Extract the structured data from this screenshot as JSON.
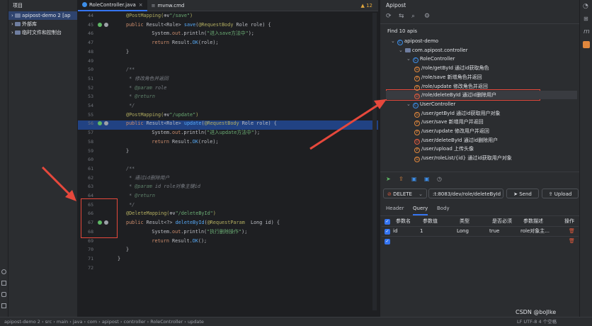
{
  "project": {
    "header": "项目",
    "items": [
      {
        "label": "apipost-demo 2 [ap"
      },
      {
        "label": "外部库"
      },
      {
        "label": "临时文件和控制台"
      }
    ]
  },
  "editor": {
    "tabs": [
      {
        "label": "RoleController.java"
      },
      {
        "label": "mvnw.cmd"
      }
    ],
    "warning_count": "12",
    "line_numbers": [
      "44",
      "45",
      "46",
      "47",
      "48",
      "49",
      "50",
      "51",
      "52",
      "53",
      "54",
      "55",
      "56",
      "57",
      "58",
      "59",
      "60",
      "61",
      "62",
      "63",
      "64",
      "65",
      "66",
      "67",
      "68",
      "69",
      "70",
      "71",
      "72"
    ],
    "lines": [
      [
        {
          "c": "an",
          "t": "@PostMapping("
        },
        {
          "c": "",
          "t": "⊕∨"
        },
        {
          "c": "st",
          "t": "\"/save\""
        },
        {
          "c": "an",
          "t": ")"
        }
      ],
      [
        {
          "c": "kw",
          "t": "public "
        },
        {
          "c": "",
          "t": "Result<Role> "
        },
        {
          "c": "fn",
          "t": "save"
        },
        {
          "c": "",
          "t": "("
        },
        {
          "c": "an",
          "t": "@RequestBody "
        },
        {
          "c": "",
          "t": "Role role) {"
        }
      ],
      [
        {
          "c": "",
          "t": "    System."
        },
        {
          "c": "kw",
          "t": "out"
        },
        {
          "c": "",
          "t": ".println("
        },
        {
          "c": "st",
          "t": "\"进入save方法中\""
        },
        {
          "c": "",
          "t": ");"
        }
      ],
      [
        {
          "c": "kw",
          "t": "    return "
        },
        {
          "c": "",
          "t": "Result."
        },
        {
          "c": "fn",
          "t": "OK"
        },
        {
          "c": "",
          "t": "(role);"
        }
      ],
      [
        {
          "c": "",
          "t": "}"
        }
      ],
      [
        {
          "c": "",
          "t": ""
        }
      ],
      [
        {
          "c": "cm",
          "t": "/**"
        }
      ],
      [
        {
          "c": "cm",
          "t": " * 修改角色并返回"
        }
      ],
      [
        {
          "c": "cm",
          "t": " * "
        },
        {
          "c": "tg",
          "t": "@param"
        },
        {
          "c": "cm",
          "t": " role"
        }
      ],
      [
        {
          "c": "cm",
          "t": " * "
        },
        {
          "c": "tg",
          "t": "@return"
        }
      ],
      [
        {
          "c": "cm",
          "t": " */"
        }
      ],
      [
        {
          "c": "an",
          "t": "@PostMapping("
        },
        {
          "c": "",
          "t": "⊕∨"
        },
        {
          "c": "st",
          "t": "\"/update\""
        },
        {
          "c": "an",
          "t": ")"
        }
      ],
      [
        {
          "c": "kw",
          "t": "public "
        },
        {
          "c": "",
          "t": "Result<Role> "
        },
        {
          "c": "fn",
          "t": "update"
        },
        {
          "c": "",
          "t": "("
        },
        {
          "c": "an",
          "t": "@RequestBody "
        },
        {
          "c": "",
          "t": "Role role) {"
        }
      ],
      [
        {
          "c": "",
          "t": "    System."
        },
        {
          "c": "kw",
          "t": "out"
        },
        {
          "c": "",
          "t": ".println("
        },
        {
          "c": "st",
          "t": "\"进入update方法中\""
        },
        {
          "c": "",
          "t": ");"
        }
      ],
      [
        {
          "c": "kw",
          "t": "    return "
        },
        {
          "c": "",
          "t": "Result."
        },
        {
          "c": "fn",
          "t": "OK"
        },
        {
          "c": "",
          "t": "(role);"
        }
      ],
      [
        {
          "c": "",
          "t": "}"
        }
      ],
      [
        {
          "c": "",
          "t": ""
        }
      ],
      [
        {
          "c": "cm",
          "t": "/**"
        }
      ],
      [
        {
          "c": "cm",
          "t": " * 通过id删除用户"
        }
      ],
      [
        {
          "c": "cm",
          "t": " * "
        },
        {
          "c": "tg",
          "t": "@param"
        },
        {
          "c": "cm",
          "t": " id role对象主键id"
        }
      ],
      [
        {
          "c": "cm",
          "t": " * "
        },
        {
          "c": "tg",
          "t": "@return"
        }
      ],
      [
        {
          "c": "cm",
          "t": " */"
        }
      ],
      [
        {
          "c": "an",
          "t": "@DeleteMapping("
        },
        {
          "c": "",
          "t": "⊕∨"
        },
        {
          "c": "st",
          "t": "\"/deleteById\""
        },
        {
          "c": "an",
          "t": ")"
        }
      ],
      [
        {
          "c": "kw",
          "t": "public "
        },
        {
          "c": "",
          "t": "Result<?> "
        },
        {
          "c": "fn",
          "t": "deleteById"
        },
        {
          "c": "",
          "t": "("
        },
        {
          "c": "an",
          "t": "@RequestParam  "
        },
        {
          "c": "",
          "t": "Long id) {"
        }
      ],
      [
        {
          "c": "",
          "t": "    System."
        },
        {
          "c": "kw",
          "t": "out"
        },
        {
          "c": "",
          "t": ".println("
        },
        {
          "c": "st",
          "t": "\"执行删除操作\""
        },
        {
          "c": "",
          "t": ");"
        }
      ],
      [
        {
          "c": "kw",
          "t": "    return "
        },
        {
          "c": "",
          "t": "Result."
        },
        {
          "c": "fn",
          "t": "OK"
        },
        {
          "c": "",
          "t": "();"
        }
      ],
      [
        {
          "c": "",
          "t": "}"
        }
      ],
      [
        {
          "c": "",
          "t": "}"
        }
      ],
      [
        {
          "c": "",
          "t": ""
        }
      ]
    ]
  },
  "apipost": {
    "title": "Apipost",
    "find_label": "Find 10 apis",
    "tree": [
      {
        "label": "apipost-demo",
        "kind": "c",
        "icon": "C"
      },
      {
        "label": "com.apipost.controller",
        "kind": "pkg",
        "icon": ""
      },
      {
        "label": "RoleController",
        "kind": "c",
        "icon": "C"
      },
      {
        "label": "/role/getById  通过id获取角色",
        "kind": "m",
        "icon": "G"
      },
      {
        "label": "/role/save  新增角色并返回",
        "kind": "m",
        "icon": "P"
      },
      {
        "label": "/role/update  修改角色并返回",
        "kind": "m",
        "icon": "P"
      },
      {
        "label": "/role/deleteById  通过id删除用户",
        "kind": "m",
        "icon": "D"
      },
      {
        "label": "UserController",
        "kind": "c",
        "icon": "C"
      },
      {
        "label": "/user/getById  通过id获取用户对象",
        "kind": "m",
        "icon": "G"
      },
      {
        "label": "/user/save  新增用户并返回",
        "kind": "m",
        "icon": "P"
      },
      {
        "label": "/user/update  修改用户并返回",
        "kind": "m",
        "icon": "P"
      },
      {
        "label": "/user/deleteById  通过id删除用户",
        "kind": "m",
        "icon": "D"
      },
      {
        "label": "/user/upload  上传头像",
        "kind": "m",
        "icon": "P"
      },
      {
        "label": "/user/roleList/{id}  通过id获取用户对象",
        "kind": "m",
        "icon": "G"
      }
    ],
    "method": "DELETE",
    "url": ":t:8083/dev/role/deleteById",
    "send_label": "Send",
    "upload_label": "Upload",
    "tabs": [
      "Header",
      "Query",
      "Body"
    ],
    "table": {
      "headers": [
        "参数名",
        "参数值",
        "类型",
        "是否必须",
        "参数描述",
        "操作"
      ],
      "rows": [
        [
          "id",
          "1",
          "Long",
          "true",
          "role对象主..."
        ],
        [
          "",
          "",
          "",
          "",
          ""
        ]
      ]
    }
  },
  "status": {
    "breadcrumb": "apipost-demo 2  ›  src  ›  main  ›  java  ›  com  ›  apipost  ›  controller  ›  RoleController  ›  update",
    "right": "LF   UTF-8   4 个空格",
    "watermark": "CSDN @boJlke"
  },
  "colors": {
    "accent": "#3574f0",
    "annotation_red": "#e6483c"
  }
}
